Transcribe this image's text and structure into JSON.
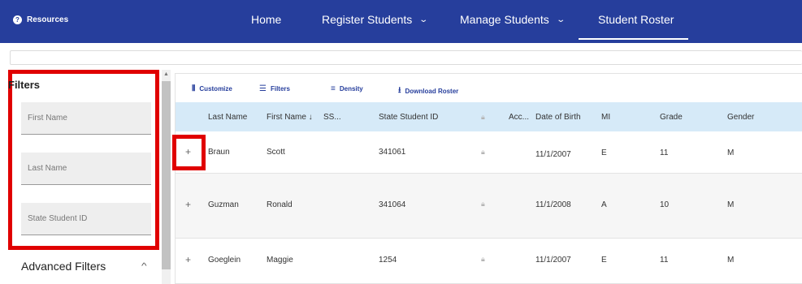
{
  "nav": {
    "resources": "Resources",
    "links": [
      {
        "label": "Home"
      },
      {
        "label": "Register Students",
        "dropdown": true
      },
      {
        "label": "Manage Students",
        "dropdown": true
      },
      {
        "label": "Student Roster",
        "active": true
      }
    ],
    "chevron": "⌄"
  },
  "filters": {
    "title": "Filters",
    "first_name_placeholder": "First Name",
    "last_name_placeholder": "Last Name",
    "state_id_placeholder": "State Student ID",
    "advanced_label": "Advanced Filters",
    "advanced_chevron": "^"
  },
  "toolbar": {
    "customize": "Customize",
    "filters": "Filters",
    "density": "Density",
    "download": "Download Roster"
  },
  "table": {
    "columns": [
      "Last Name",
      "First Name ↓",
      "SS...",
      "State Student ID",
      "Acc...",
      "Date of Birth",
      "MI",
      "Grade",
      "Gender"
    ],
    "rows": [
      {
        "last": "Braun",
        "first": "Scott",
        "ssid": "341061",
        "dob": "11/1/2007",
        "mi": "E",
        "grade": "11",
        "gender": "M"
      },
      {
        "last": "Guzman",
        "first": "Ronald",
        "ssid": "341064",
        "dob": "11/1/2008",
        "mi": "A",
        "grade": "10",
        "gender": "M"
      },
      {
        "last": "Goeglein",
        "first": "Maggie",
        "ssid": "1254",
        "dob": "11/1/2007",
        "mi": "E",
        "grade": "11",
        "gender": "M"
      }
    ]
  },
  "colors": {
    "nav_bg": "#263e9c",
    "header_bg": "#d6eaf8",
    "highlight": "#e00000"
  }
}
